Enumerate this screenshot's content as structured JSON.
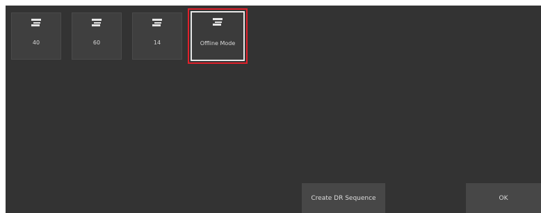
{
  "tiles": [
    {
      "label": "40",
      "icon": "detector-icon"
    },
    {
      "label": "60",
      "icon": "detector-icon"
    },
    {
      "label": "14",
      "icon": "detector-icon"
    },
    {
      "label": "Offline Mode",
      "icon": "detector-icon",
      "selected": true
    }
  ],
  "buttons": {
    "create_dr_sequence": "Create DR Sequence",
    "ok": "OK"
  },
  "colors": {
    "panel_bg": "#333333",
    "tile_bg": "#3f3f3f",
    "button_bg": "#474747",
    "highlight": "#e0202a"
  }
}
